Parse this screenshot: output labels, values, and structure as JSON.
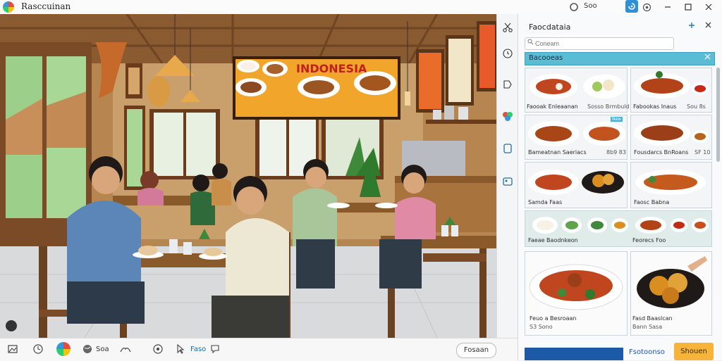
{
  "app": {
    "title": "Rasccuinan"
  },
  "titlebar": {
    "count": "Soo",
    "icons": [
      "app-logo",
      "refresh-icon",
      "accent-icon",
      "settings-icon",
      "minimize-icon",
      "maximize-icon",
      "close-icon"
    ]
  },
  "scene": {
    "sign_text": "INDONESIA"
  },
  "bottombar": {
    "label_count": "Soa",
    "label_link": "Faso",
    "button_label": "Fosaan",
    "icons": [
      "photo-icon",
      "clock-icon",
      "color-wheel-icon",
      "globe-icon",
      "layers-icon",
      "gear-icon",
      "cursor-icon",
      "chat-icon"
    ]
  },
  "toolstrip": {
    "icons": [
      "scissors-icon",
      "timer-icon",
      "tag-icon",
      "palette-icon",
      "frame-icon",
      "image-icon"
    ]
  },
  "panel": {
    "title": "Faocdataia",
    "search_placeholder": "Coneam",
    "section_label": "Bacooeas",
    "cards": [
      {
        "caption": "Faooak Enleaanan",
        "caption2": "Sosso Brmbuld"
      },
      {
        "caption": "Fabookas Inaus",
        "caption2": "Sou 8s"
      },
      {
        "caption": "Bameatnan Saeriacs",
        "caption2": "8b9 83"
      },
      {
        "caption": "Fousdarcs BnRoans",
        "caption2": "SF 10"
      },
      {
        "caption": "Samda Faas",
        "caption2": ""
      },
      {
        "caption": "Faosc Babna",
        "caption2": ""
      },
      {
        "caption": "Faeae Baodnkeon",
        "caption2": ""
      },
      {
        "caption": "Feorecs Foo",
        "caption2": ""
      },
      {
        "caption": "Feuo a Besroaan",
        "caption2": "S3 Sono"
      },
      {
        "caption": "Fasd Baaslcan",
        "caption2": "Bann Sasa"
      }
    ],
    "badge": "New",
    "secondary_label": "Fsotoonso",
    "accent_button": "Shouen"
  },
  "colors": {
    "accent": "#2f8fd8",
    "section": "#5bbdd4",
    "primary_button": "#1c5aa8",
    "accent_button": "#f7b43a"
  }
}
